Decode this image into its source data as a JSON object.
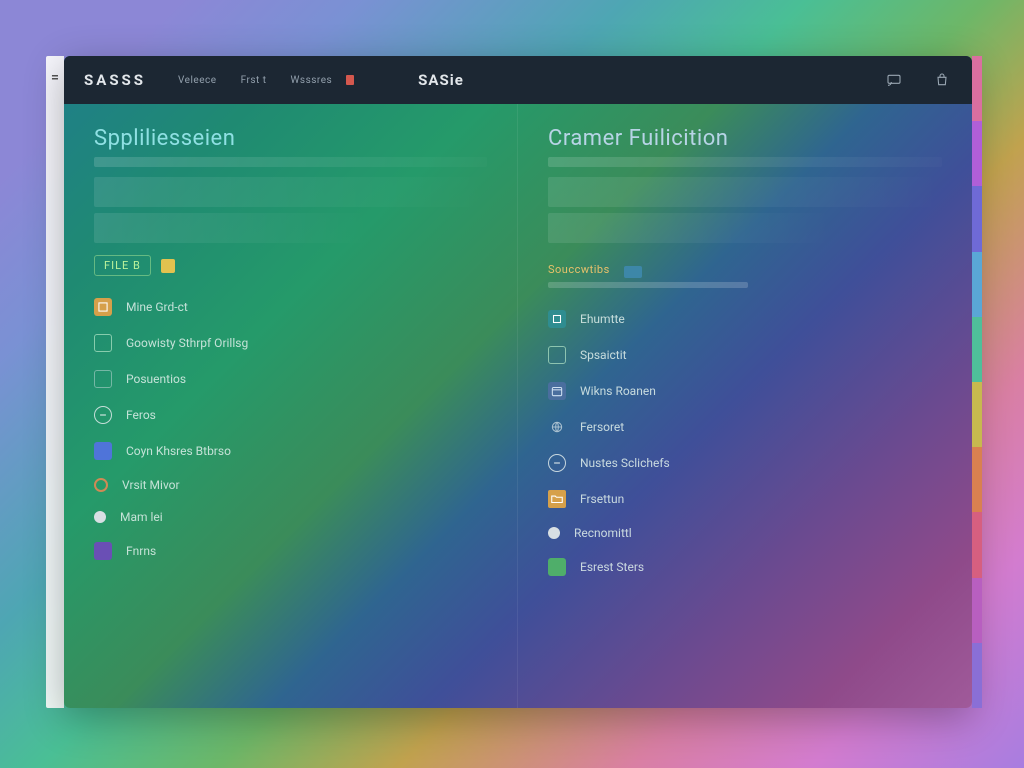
{
  "microStrip": {
    "glyph": "="
  },
  "topbar": {
    "brandLeft": "SASSS",
    "nav": [
      "Veleece",
      "Frst t",
      "Wsssres"
    ],
    "brandRight": "SASie"
  },
  "panes": {
    "left": {
      "title": "Sppliliesseien",
      "pill": "FILE B",
      "items": [
        {
          "icon": "box-orange",
          "label": "Mine Grd-ct"
        },
        {
          "icon": "outline",
          "label": "Goowisty Sthrpf Orillsg"
        },
        {
          "icon": "outline-dim",
          "label": "Posuentios"
        },
        {
          "icon": "minus",
          "label": "Feros"
        },
        {
          "icon": "blue",
          "label": "Coyn Khsres Btbrso"
        },
        {
          "icon": "ring",
          "label": "Vrsit Mivor"
        },
        {
          "icon": "dot",
          "label": "Mam lei"
        },
        {
          "icon": "purple",
          "label": "Fnrns"
        }
      ]
    },
    "right": {
      "title": "Cramer Fuilicition",
      "section": "Souccwtibs",
      "items": [
        {
          "icon": "teal",
          "label": "Ehumtte"
        },
        {
          "icon": "outline",
          "label": "Spsaictit"
        },
        {
          "icon": "cal",
          "label": "Wikns Roanen"
        },
        {
          "icon": "globe",
          "label": "Fersoret"
        },
        {
          "icon": "minus",
          "label": "Nustes Sclichefs"
        },
        {
          "icon": "folder",
          "label": "Frsettun"
        },
        {
          "icon": "dot",
          "label": "Recnomittl"
        },
        {
          "icon": "green",
          "label": "Esrest Sters"
        }
      ]
    }
  }
}
